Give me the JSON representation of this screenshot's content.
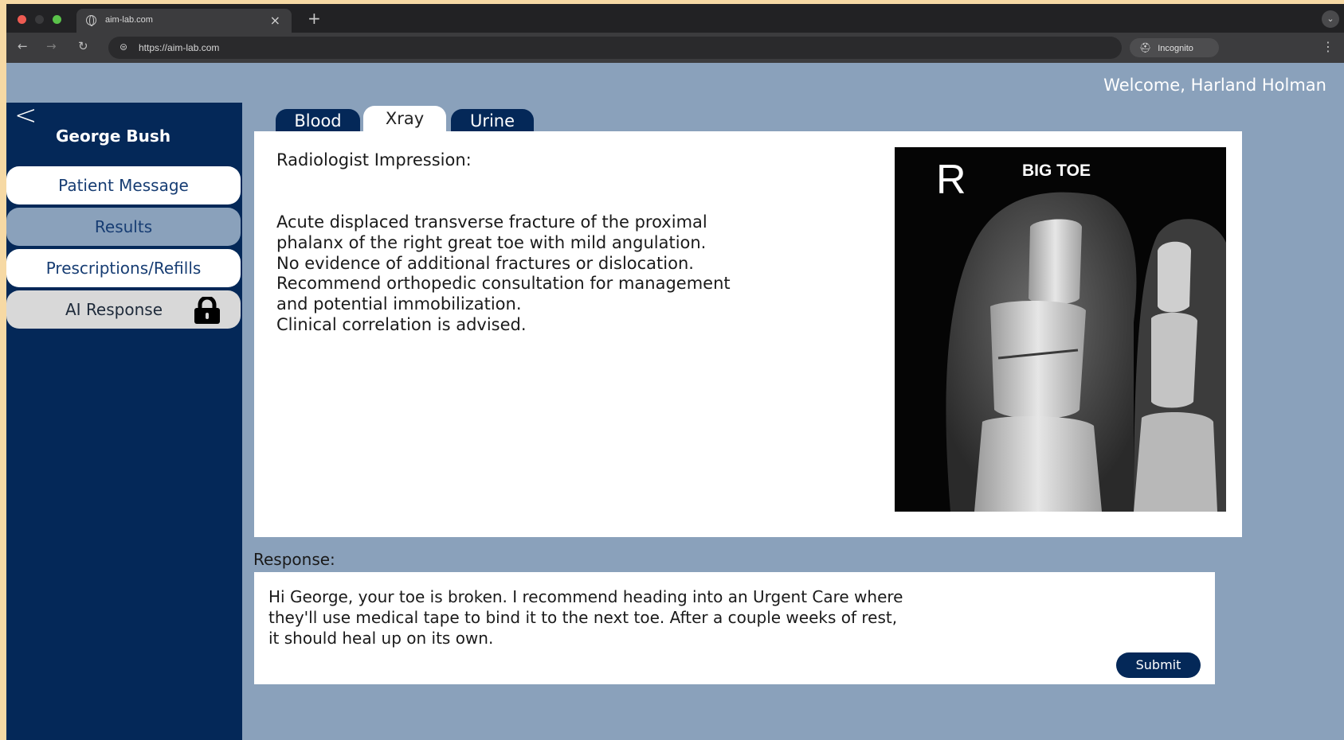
{
  "browser": {
    "tab_title": "aim-lab.com",
    "url": "https://aim-lab.com",
    "incognito_label": "Incognito"
  },
  "header": {
    "welcome": "Welcome, Harland Holman"
  },
  "sidebar": {
    "patient_name": "George Bush",
    "items": [
      {
        "label": "Patient Message"
      },
      {
        "label": "Results"
      },
      {
        "label": "Prescriptions/Refills"
      },
      {
        "label": "AI Response",
        "locked": true
      }
    ]
  },
  "results": {
    "tabs": [
      {
        "label": "Blood",
        "active": false
      },
      {
        "label": "Xray",
        "active": true
      },
      {
        "label": "Urine",
        "active": false
      }
    ],
    "impression_label": "Radiologist Impression:",
    "impression_lines": [
      "Acute displaced transverse fracture of the proximal",
      "phalanx of the right great toe with mild angulation.",
      "No evidence of additional fractures or dislocation.",
      "Recommend orthopedic consultation for management",
      "and potential immobilization.",
      "Clinical correlation is advised."
    ],
    "xray": {
      "marker": "R",
      "caption": "BIG TOE"
    }
  },
  "response": {
    "label": "Response:",
    "lines": [
      "Hi George, your toe is broken. I recommend heading into an Urgent Care where",
      "they'll use medical tape to bind it to the next toe. After a couple weeks of rest,",
      "it should heal up on its own."
    ],
    "submit_label": "Submit"
  },
  "colors": {
    "navy": "#042858",
    "steel": "#8aa1bb",
    "frame": "#f6d9a4"
  }
}
